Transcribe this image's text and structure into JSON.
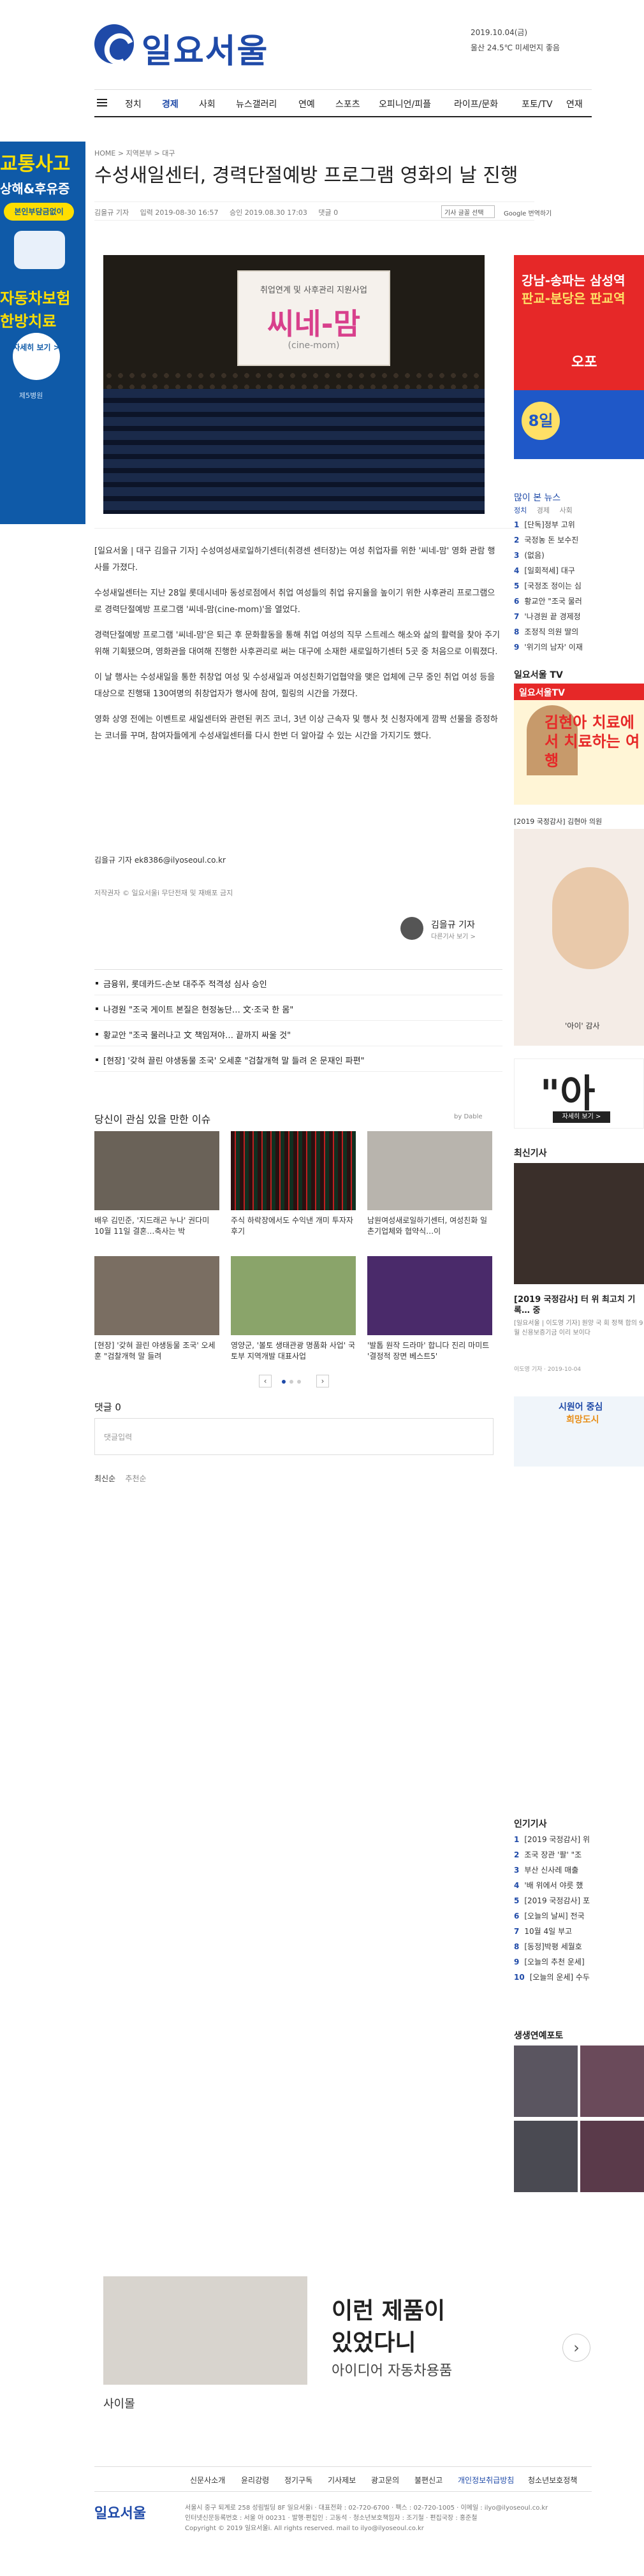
{
  "header": {
    "logo": "일요서울",
    "date": "2019.10.04(금)",
    "weather": "울산 24.5℃ 미세먼지 좋음"
  },
  "nav": {
    "items": [
      "정치",
      "경제",
      "사회",
      "뉴스갤러리",
      "연예",
      "스포츠",
      "오피니언/피플",
      "라이프/문화",
      "포토/TV",
      "연재"
    ],
    "active": "경제"
  },
  "left_ad": {
    "line1": "교통사고",
    "line2": "상해&후유증",
    "pill": "본인부담금없이",
    "line3": "자동차보험",
    "line4": "한방치료",
    "button": "자세히 보기 >",
    "footer": "제5병원"
  },
  "article": {
    "breadcrumb": "HOME  >  지역본부  >  대구",
    "headline": "수성새일센터, 경력단절예방 프로그램 영화의 날 진행",
    "author": "김을규 기자",
    "published": "입력 2019-08-30 16:57",
    "updated": "승인 2019.08.30 17:03",
    "comments": "댓글 0",
    "font_select": "기사 글꼴 선택",
    "translate": "Google 번역하기",
    "photo_banner": "취업연계 및 사후관리 지원사업",
    "photo_title": "씨네-맘",
    "photo_subtitle": "(cine-mom)",
    "paragraphs": [
      "[일요서울 | 대구 김을규 기자] 수성여성새로일하기센터(취경센 센터장)는 여성 취업자를 위한 '씨네-맘' 영화 관람 행사를 가졌다.",
      "수성새일센터는 지난 28일 롯데시네마 동성로점에서 취업 여성들의 취업 유지율을 높이기 위한 사후관리 프로그램으로 경력단절예방 프로그램 '씨네-맘(cine-mom)'을 열었다.",
      "경력단절예방 프로그램 '씨네-맘'은 퇴근 후 문화활동을 통해 취업 여성의 직무 스트레스 해소와 삶의 활력을 찾아 주기 위해 기획됐으며, 영화관을 대여해 진행한 사후관리로 써는 대구에 소재한 새로일하기센터 5곳 중 처음으로 이뤄졌다.",
      "이 날 행사는 수성새일을 통한 취창업 여성 및 수성새일과 여성친화기업협약을 맺은 업체에 근무 중인 취업 여성 등을 대상으로 진행돼 130여명의 취창업자가 행사에 참여, 힐링의 시간을 가졌다.",
      "영화 상영 전에는 이벤트로 새일센터와 관련된 퀴즈 코너, 3년 이상 근속자 및 행사 첫 신청자에게 깜짝 선물을 증정하는 코너를 꾸며, 참여자들에게 수성새일센터를 다시 한번 더 알아갈 수 있는 시간을 가지기도 했다."
    ],
    "byline": "김을규 기자 ek8386@ilyoseoul.co.kr",
    "copyright": "저작권자 © 일요서울i 무단전재 및 재배포 금지",
    "reporter_name": "김을규 기자",
    "reporter_more": "다른기사 보기 >"
  },
  "related": [
    "금융위, 롯데카드-손보 대주주 적격성 심사 승인",
    "나경원 \"조국 게이트 본질은 현정농단… 文·조국 한 몸\"",
    "황교안 \"조국 물러나고 文 책임져야… 끝까지 싸울 것\"",
    "[현장] '갖혀 끌린 야생동물 조국' 오세훈 \"검찰개혁 말 들려 온 문재인 파편\""
  ],
  "recommend": {
    "title": "당신이 관심 있을 만한 이슈",
    "by": "by Dable",
    "items": [
      "배우 김민준, '지드래곤 누나' 권다미 10월 11일 결혼…축사는 박",
      "주식 하락장에서도 수익낸 개미 투자자 후기",
      "남원여성새로일하기센터, 여성친화 일촌기업체와 협약식…이",
      "[현장] '갖혀 끌린 야생동물 조국' 오세훈 \"검찰개혁 말 들려",
      "영양군, '볼토 생태관광 명품화 사업' 국토부 지역개발 대표사업",
      "'발톱 원작 드라마' 합니다 진리 마미트 '결정적 장면 베스트5'"
    ]
  },
  "comments": {
    "title": "댓글 0",
    "placeholder": "댓글입력",
    "sort_new": "최신순",
    "sort_rec": "추천순"
  },
  "sidebar": {
    "ad1_line1": "강남-송파는 삼성역",
    "ad1_line2": "판교-분당은 판교역",
    "ad1_badge": "8일",
    "ad1_brand": "오포",
    "mostread_title": "많이 본 뉴스",
    "mostread_tabs": [
      "정치",
      "경제",
      "사회"
    ],
    "mostread": [
      "[단독]정부 고위",
      "국정농 돈 보수진",
      "(없음)",
      "[일회적세] 대구",
      "[국정조 정이는 심",
      "황교안 \"조국 물러",
      "'나경원 끝 경제정",
      "조정직 의원 딸의",
      "'위기의 남자' 이재"
    ],
    "tv_title": "일요서울 TV",
    "tv_brand": "일요서울TV",
    "tv_text": "김현아 치료에서 치료하는 여행",
    "tv_caption": "[2019 국정감사] 김현아 의원",
    "ad2_caption": "'아이' 감사",
    "ad3_btn": "자세히 보기 >",
    "latest_title": "최신기사",
    "latest_headline": "[2019 국정감사] 터 위 최고치 기록… 중",
    "latest_summary": "[일요서울 | 이도영 기자] 원양 국 회 정책 합의 9월 신용보증기금 이리 보이다",
    "latest_meta": "이도영 기자 · 2019-10-04",
    "ad4_line1": "시원어 중심",
    "ad4_line2": "희망도시",
    "popular_title": "인기기사",
    "popular": [
      "[2019 국정감사] 위",
      "조국 장관 '팔' \"조",
      "부산 신사레 매출",
      "'배 위에서 야릇 했",
      "[2019 국정감사] 포",
      "[오늘의 날씨] 전국",
      "10월 4일 부고",
      "[동정]박평 세월호",
      "[오늘의 추천 운세]",
      "[오늘의 운세] 수두"
    ],
    "photo_title": "생생연예포토"
  },
  "bottom_ad": {
    "line1": "이런 제품이",
    "line2": "있었다니",
    "line3": "아이디어 자동차용품",
    "brand": "사이몰"
  },
  "footer": {
    "nav": [
      "신문사소개",
      "윤리강령",
      "정기구독",
      "기사제보",
      "광고문의",
      "불편신고",
      "개인정보취급방침",
      "청소년보호정책"
    ],
    "logo": "일요서울",
    "info1": "서울시 중구 퇴계로 258 성림빌딩 8F 일요서울i · 대표전화 : 02-720-6700 · 팩스 : 02-720-1005 · 이메일 : ilyo@ilyoseoul.co.kr",
    "info2": "인터넷신문등록번호 : 서울 아 00231 · 발행·편집인 : 고동석 · 청소년보호책임자 : 조기철 · 편집국장 : 홍준철",
    "info3": "Copyright © 2019 일요서울i. All rights reserved. mail to ilyo@ilyoseoul.co.kr"
  }
}
